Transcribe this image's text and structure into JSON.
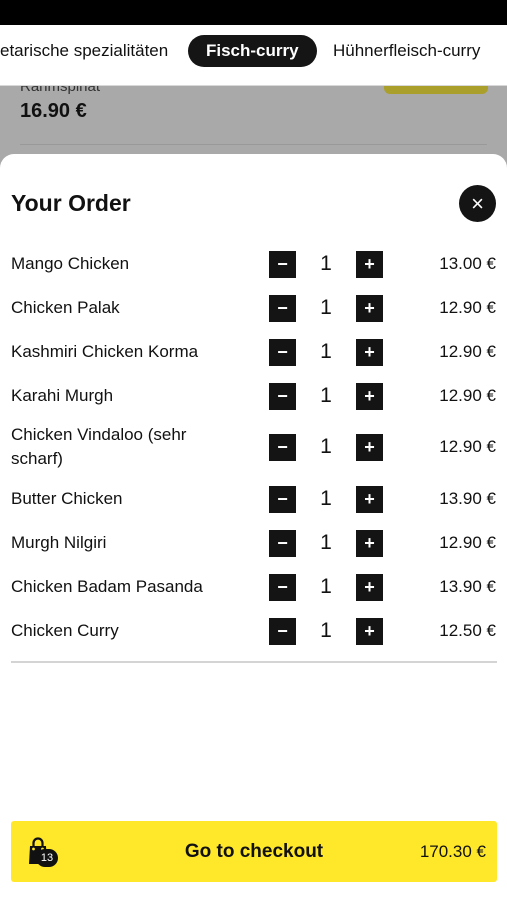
{
  "categories": [
    {
      "label": "etarische spezialitäten",
      "active": false
    },
    {
      "label": "Fisch-curry",
      "active": true
    },
    {
      "label": "Hühnerfleisch-curry",
      "active": false
    }
  ],
  "background_item": {
    "description": "Rahmspinat",
    "price": "16.90 €"
  },
  "order": {
    "title": "Your Order",
    "close_icon": "×",
    "items": [
      {
        "name": "Mango Chicken",
        "qty": "1",
        "price": "13.00 €"
      },
      {
        "name": "Chicken Palak",
        "qty": "1",
        "price": "12.90 €"
      },
      {
        "name": "Kashmiri Chicken Korma",
        "qty": "1",
        "price": "12.90 €"
      },
      {
        "name": "Karahi Murgh",
        "qty": "1",
        "price": "12.90 €"
      },
      {
        "name": "Chicken Vindaloo (sehr scharf)",
        "qty": "1",
        "price": "12.90 €"
      },
      {
        "name": "Butter Chicken",
        "qty": "1",
        "price": "13.90 €"
      },
      {
        "name": "Murgh Nilgiri",
        "qty": "1",
        "price": "12.90 €"
      },
      {
        "name": "Chicken Badam Pasanda",
        "qty": "1",
        "price": "13.90 €"
      },
      {
        "name": "Chicken Curry",
        "qty": "1",
        "price": "12.50 €"
      }
    ],
    "minus_symbol": "−",
    "plus_symbol": "+"
  },
  "checkout": {
    "label": "Go to checkout",
    "total": "170.30 €",
    "cart_count": "13",
    "icon": "shopping-bag-icon"
  },
  "colors": {
    "accent_yellow": "#ffe82a",
    "dark": "#141414"
  }
}
